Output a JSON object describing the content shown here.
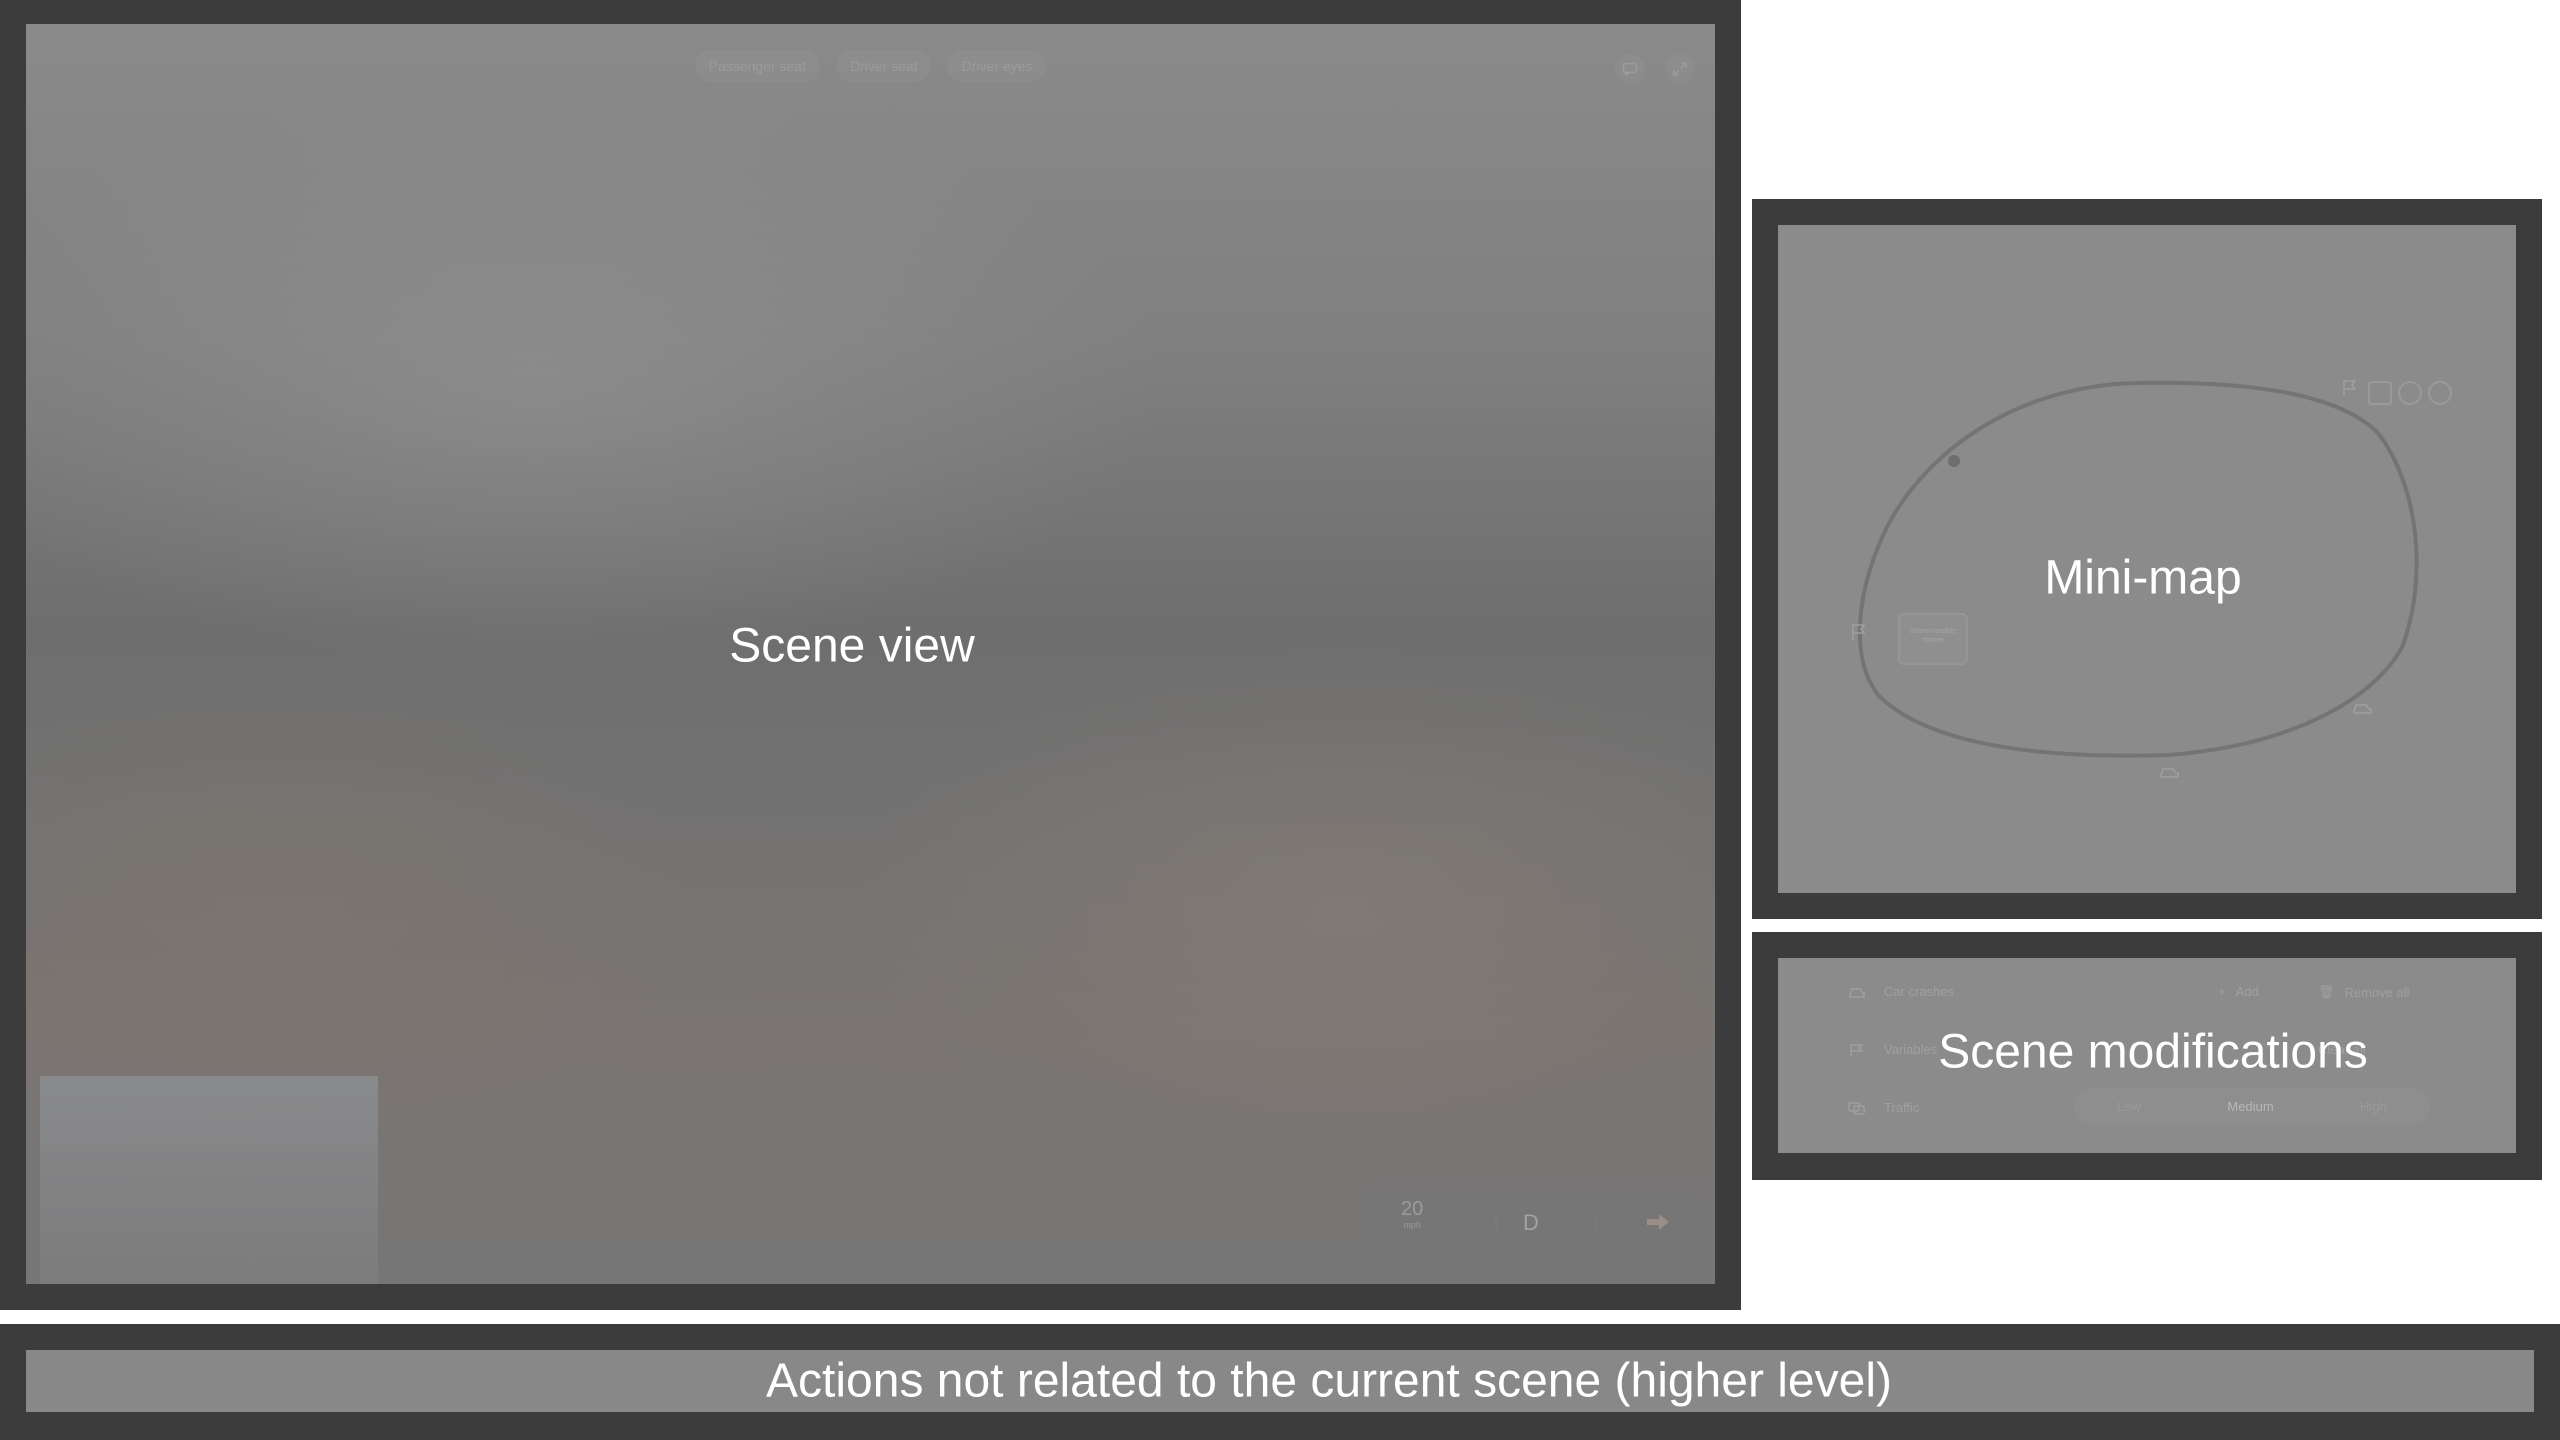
{
  "scene_view": {
    "label": "Scene view",
    "camera_tabs": [
      "Passenger seat",
      "Driver seat",
      "Driver eyes"
    ],
    "dashboard": {
      "speed_value": "20",
      "speed_unit": "mph",
      "gear": "D"
    },
    "icons": [
      "comment-icon",
      "expand-icon",
      "turn-arrow-icon"
    ]
  },
  "mini_map": {
    "label": "Mini-map",
    "note_text": "Scene/variable marker",
    "icons": [
      "flag-icon",
      "car-icon",
      "close-icon",
      "zoom-in-icon",
      "zoom-out-icon"
    ]
  },
  "scene_modifications": {
    "label": "Scene modifications",
    "rows": [
      {
        "label": "Car crashes",
        "action1": "Add",
        "action2": "Remove all"
      },
      {
        "label": "Variables",
        "action2": "Clear all"
      },
      {
        "label": "Traffic"
      }
    ],
    "traffic_options": [
      "Low",
      "Medium",
      "High"
    ],
    "traffic_selected": "Medium"
  },
  "actions_bar": {
    "label": "Actions not related to the current scene (higher level)"
  },
  "colors": {
    "frame": "#3c3c3c",
    "panel": "#8a8a8a",
    "label_text": "#ffffff"
  }
}
